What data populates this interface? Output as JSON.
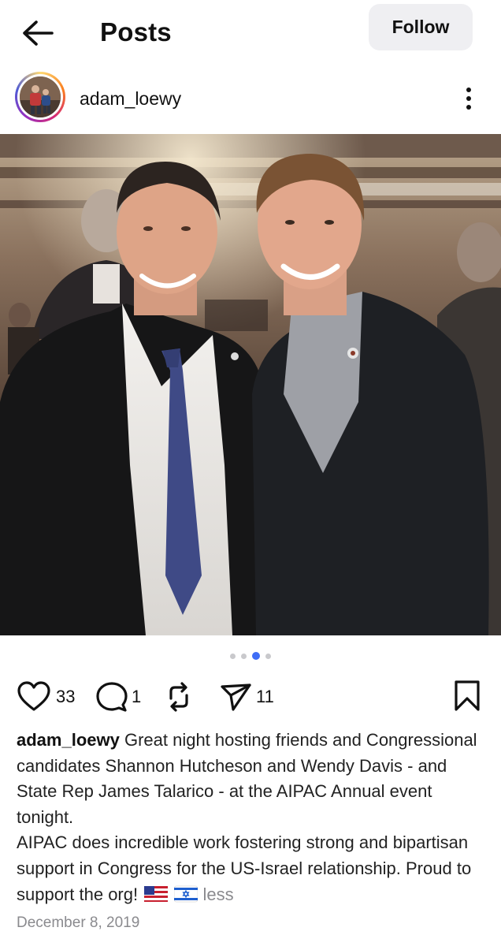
{
  "header": {
    "title": "Posts",
    "follow_label": "Follow"
  },
  "profile": {
    "username": "adam_loewy"
  },
  "carousel": {
    "total": 4,
    "active_index": 2
  },
  "actions": {
    "likes": "33",
    "comments": "1",
    "shares": "11"
  },
  "caption": {
    "author": "adam_loewy",
    "line1": " Great night hosting friends and Congressional candidates Shannon Hutcheson and Wendy Davis - and State Rep James Talarico - at the AIPAC Annual event tonight.",
    "line2": "AIPAC does incredible work fostering strong and bipartisan support in Congress for the US-Israel relationship. Proud to support the org!",
    "less_label": "less",
    "flags": [
      "us-flag-emoji",
      "israel-flag-emoji"
    ]
  },
  "post_date": "December 8, 2019",
  "colors": {
    "accent_dot": "#3f6df6",
    "follow_bg": "#efeff2",
    "muted_text": "#8a8a8e"
  }
}
